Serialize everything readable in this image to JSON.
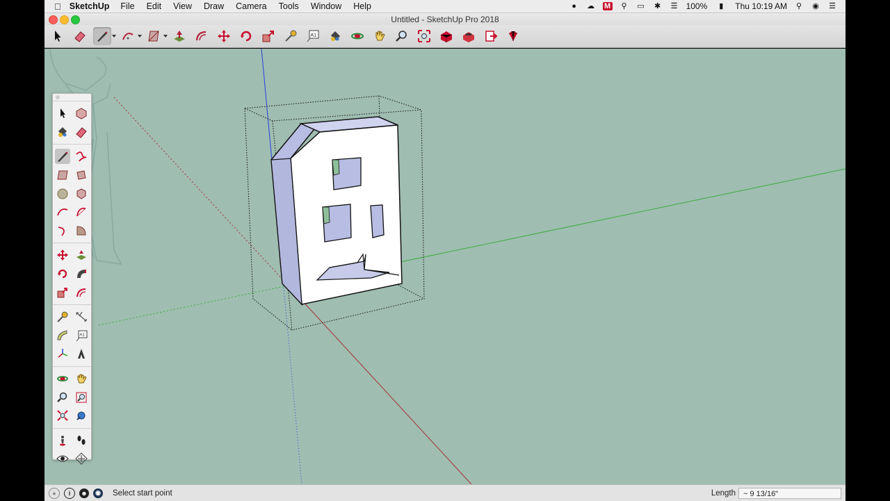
{
  "menubar": {
    "app_name": "SketchUp",
    "items": [
      "File",
      "Edit",
      "View",
      "Draw",
      "Camera",
      "Tools",
      "Window",
      "Help"
    ],
    "status": {
      "battery": "100%",
      "clock": "Thu 10:19 AM",
      "mail_badge": "M"
    }
  },
  "window": {
    "title": "Untitled - SketchUp Pro 2018"
  },
  "toolbar": {
    "tools": [
      {
        "name": "select-tool",
        "icon": "arrow-icon"
      },
      {
        "name": "eraser-tool",
        "icon": "eraser-icon"
      },
      {
        "name": "line-tool",
        "icon": "pencil-icon",
        "active": true,
        "dropdown": true
      },
      {
        "name": "arc-tool",
        "icon": "arc-icon",
        "dropdown": true
      },
      {
        "name": "rectangle-tool",
        "icon": "rectangle-icon",
        "dropdown": true
      },
      {
        "name": "push-pull-tool",
        "icon": "push-pull-icon"
      },
      {
        "name": "offset-tool",
        "icon": "offset-icon"
      },
      {
        "name": "move-tool",
        "icon": "move-icon"
      },
      {
        "name": "rotate-tool",
        "icon": "rotate-icon"
      },
      {
        "name": "scale-tool",
        "icon": "scale-icon"
      },
      {
        "name": "tape-measure-tool",
        "icon": "tape-icon"
      },
      {
        "name": "text-tool",
        "icon": "text-icon"
      },
      {
        "name": "paint-bucket-tool",
        "icon": "paint-bucket-icon"
      },
      {
        "name": "orbit-tool",
        "icon": "orbit-icon"
      },
      {
        "name": "pan-tool",
        "icon": "hand-icon"
      },
      {
        "name": "zoom-tool",
        "icon": "zoom-icon"
      },
      {
        "name": "zoom-extents-tool",
        "icon": "zoom-extents-icon"
      },
      {
        "name": "3d-warehouse-button",
        "icon": "warehouse-icon"
      },
      {
        "name": "extension-warehouse-button",
        "icon": "extension-icon"
      },
      {
        "name": "send-to-layout-button",
        "icon": "layout-icon"
      },
      {
        "name": "extension-manager-button",
        "icon": "ruby-icon"
      }
    ]
  },
  "text_tool_label": "A1",
  "statusbar": {
    "hint": "Select start point",
    "length_label": "Length",
    "length_value": "~ 9 13/16\""
  },
  "colors": {
    "viewport_bg": "#9fbdb1",
    "axis_red": "#a8323a",
    "axis_green": "#3aad3a",
    "axis_blue": "#2a3fe0",
    "face_front": "#ffffff",
    "face_back": "#b8bde3"
  }
}
